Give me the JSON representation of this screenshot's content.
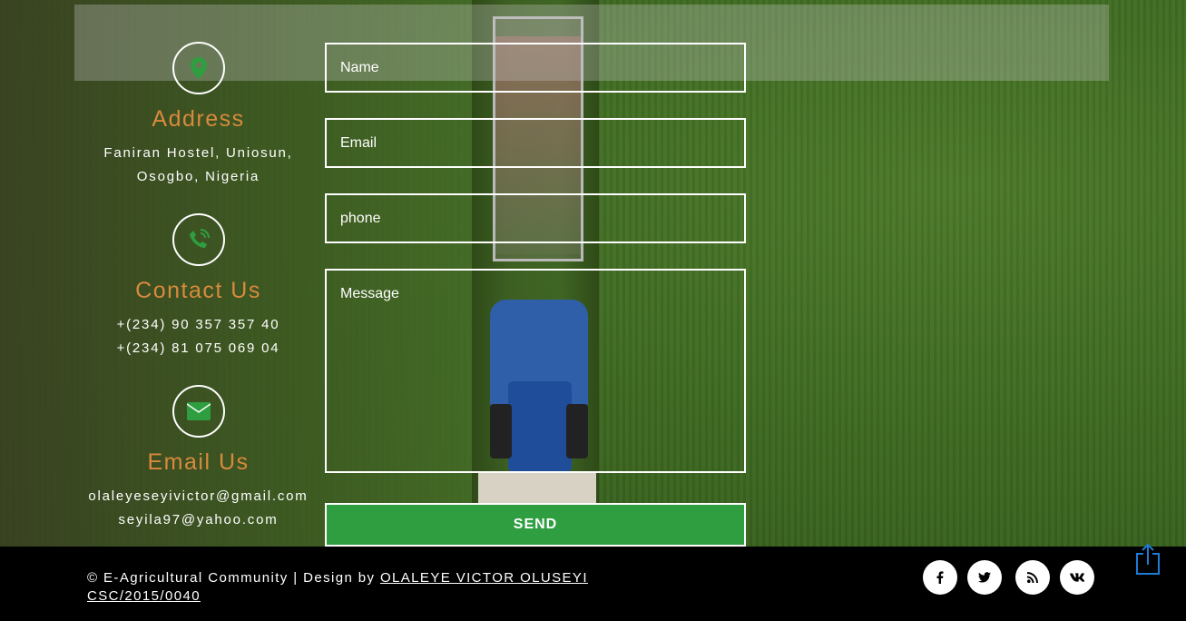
{
  "contact": {
    "address": {
      "icon": "map-marker-icon",
      "title": "Address",
      "lines": [
        "Faniran Hostel, Uniosun,",
        "Osogbo, Nigeria"
      ]
    },
    "phone": {
      "icon": "phone-icon",
      "title": "Contact Us",
      "lines": [
        "+(234) 90 357 357 40",
        "+(234) 81 075 069 04"
      ]
    },
    "email": {
      "icon": "envelope-icon",
      "title": "Email Us",
      "lines": [
        "olaleyeseyivictor@gmail.com",
        "seyila97@yahoo.com"
      ]
    }
  },
  "form": {
    "name_placeholder": "Name",
    "email_placeholder": "Email",
    "phone_placeholder": "phone",
    "message_placeholder": "Message",
    "send_label": "SEND"
  },
  "footer": {
    "copyright_prefix": "© E-Agricultural Community | Design by ",
    "designer_link": "OLALEYE VICTOR OLUSEYI",
    "designer_id": "CSC/2015/0040",
    "social": [
      {
        "name": "facebook",
        "glyph": "f"
      },
      {
        "name": "twitter",
        "glyph": "t"
      },
      {
        "name": "rss",
        "glyph": "rss"
      },
      {
        "name": "vk",
        "glyph": "vk"
      }
    ]
  },
  "colors": {
    "accent_orange": "#d88a3c",
    "icon_green": "#2f9e41",
    "send_green": "#2f9e41",
    "footer_bg": "#000000",
    "share_blue": "#1e7bd6"
  }
}
